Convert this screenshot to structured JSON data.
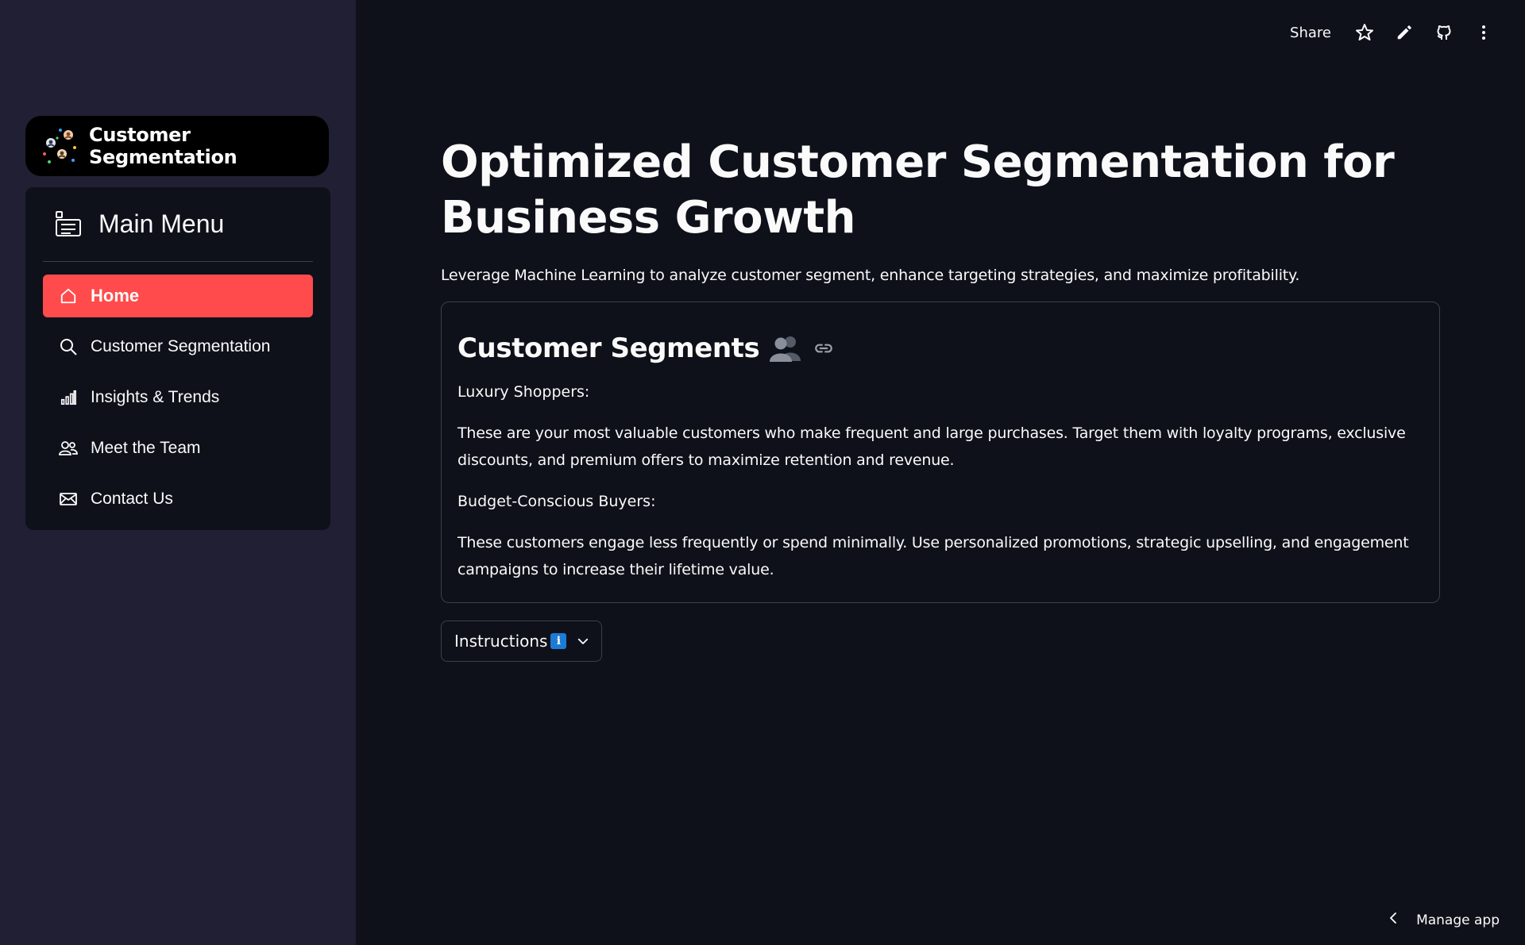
{
  "sidebar": {
    "brand_title": "Customer Segmentation",
    "menu_title": "Main Menu",
    "items": [
      {
        "label": "Home",
        "icon": "house-icon",
        "active": true
      },
      {
        "label": "Customer Segmentation",
        "icon": "search-icon",
        "active": false
      },
      {
        "label": "Insights & Trends",
        "icon": "bar-chart-icon",
        "active": false
      },
      {
        "label": "Meet the Team",
        "icon": "people-icon",
        "active": false
      },
      {
        "label": "Contact Us",
        "icon": "envelope-icon",
        "active": false
      }
    ]
  },
  "topbar": {
    "share_label": "Share",
    "icons": [
      "star-icon",
      "pencil-icon",
      "github-icon",
      "more-vertical-icon"
    ]
  },
  "main": {
    "title": "Optimized Customer Segmentation for Business Growth",
    "subtitle": "Leverage Machine Learning to analyze customer segment, enhance targeting strategies, and maximize profitability.",
    "card": {
      "title": "Customer Segments",
      "segments": [
        {
          "name": "Luxury Shoppers:",
          "description": "These are your most valuable customers who make frequent and large purchases. Target them with loyalty programs, exclusive discounts, and premium offers to maximize retention and revenue."
        },
        {
          "name": "Budget-Conscious Buyers:",
          "description": "These customers engage less frequently or spend minimally. Use personalized promotions, strategic upselling, and engagement campaigns to increase their lifetime value."
        }
      ]
    },
    "expander_label": "Instructions",
    "info_glyph": "i"
  },
  "footer": {
    "manage_label": "Manage app"
  },
  "colors": {
    "sidebar_bg": "#201f33",
    "main_bg": "#0f111a",
    "accent": "#ff4b4b",
    "info_blue": "#1c7cd5"
  }
}
